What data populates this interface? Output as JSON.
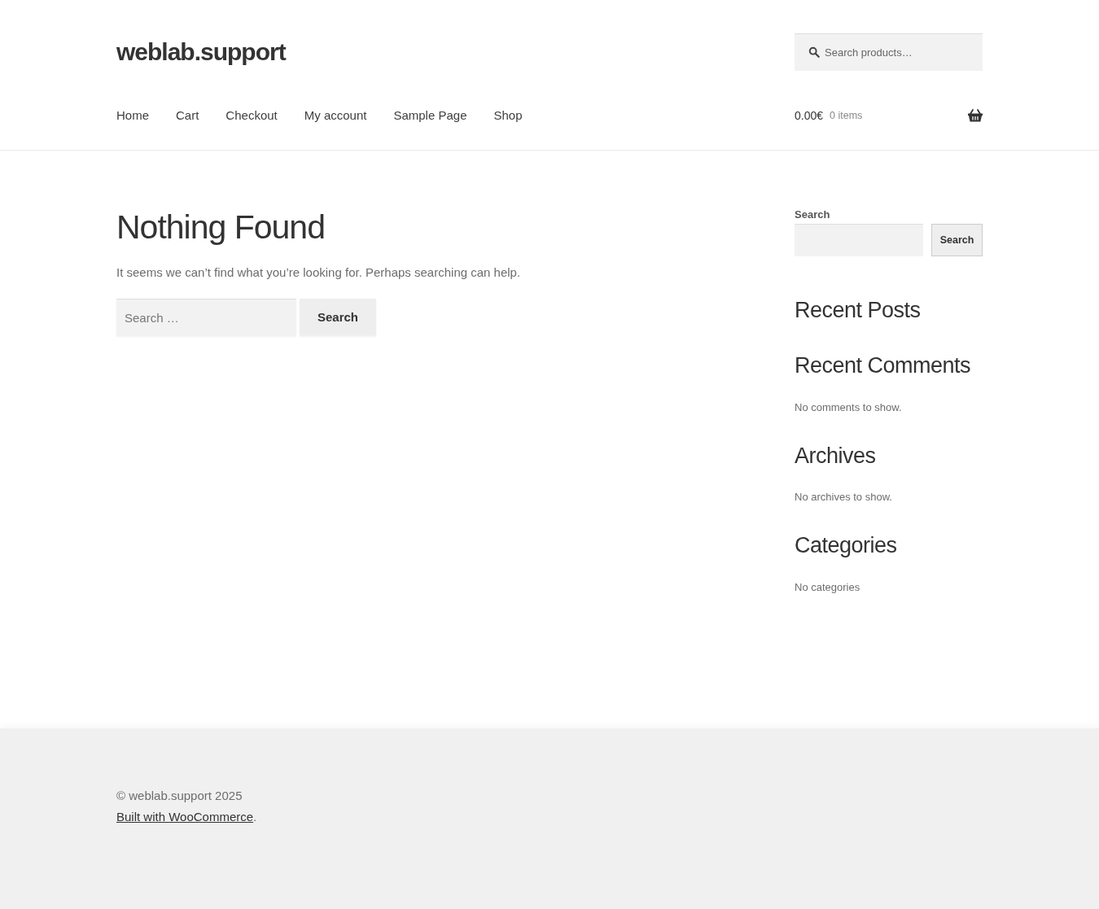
{
  "site": {
    "title": "weblab.support"
  },
  "header_search": {
    "placeholder": "Search products…"
  },
  "nav": [
    {
      "label": "Home"
    },
    {
      "label": "Cart"
    },
    {
      "label": "Checkout"
    },
    {
      "label": "My account"
    },
    {
      "label": "Sample Page"
    },
    {
      "label": "Shop"
    }
  ],
  "cart": {
    "amount": "0.00€",
    "count": "0 items"
  },
  "main": {
    "title": "Nothing Found",
    "text": "It seems we can’t find what you’re looking for. Perhaps searching can help.",
    "search_placeholder": "Search …",
    "search_button": "Search"
  },
  "widgets": [
    {
      "kind": "search",
      "label": "Search",
      "button": "Search"
    },
    {
      "kind": "section",
      "title": "Recent Posts"
    },
    {
      "kind": "section",
      "title": "Recent Comments",
      "text": "No comments to show."
    },
    {
      "kind": "section",
      "title": "Archives",
      "text": "No archives to show."
    },
    {
      "kind": "section",
      "title": "Categories",
      "text": "No categories"
    }
  ],
  "footer": {
    "copyright": "© weblab.support 2025",
    "credit_link": "Built with WooCommerce",
    "credit_suffix": "."
  }
}
